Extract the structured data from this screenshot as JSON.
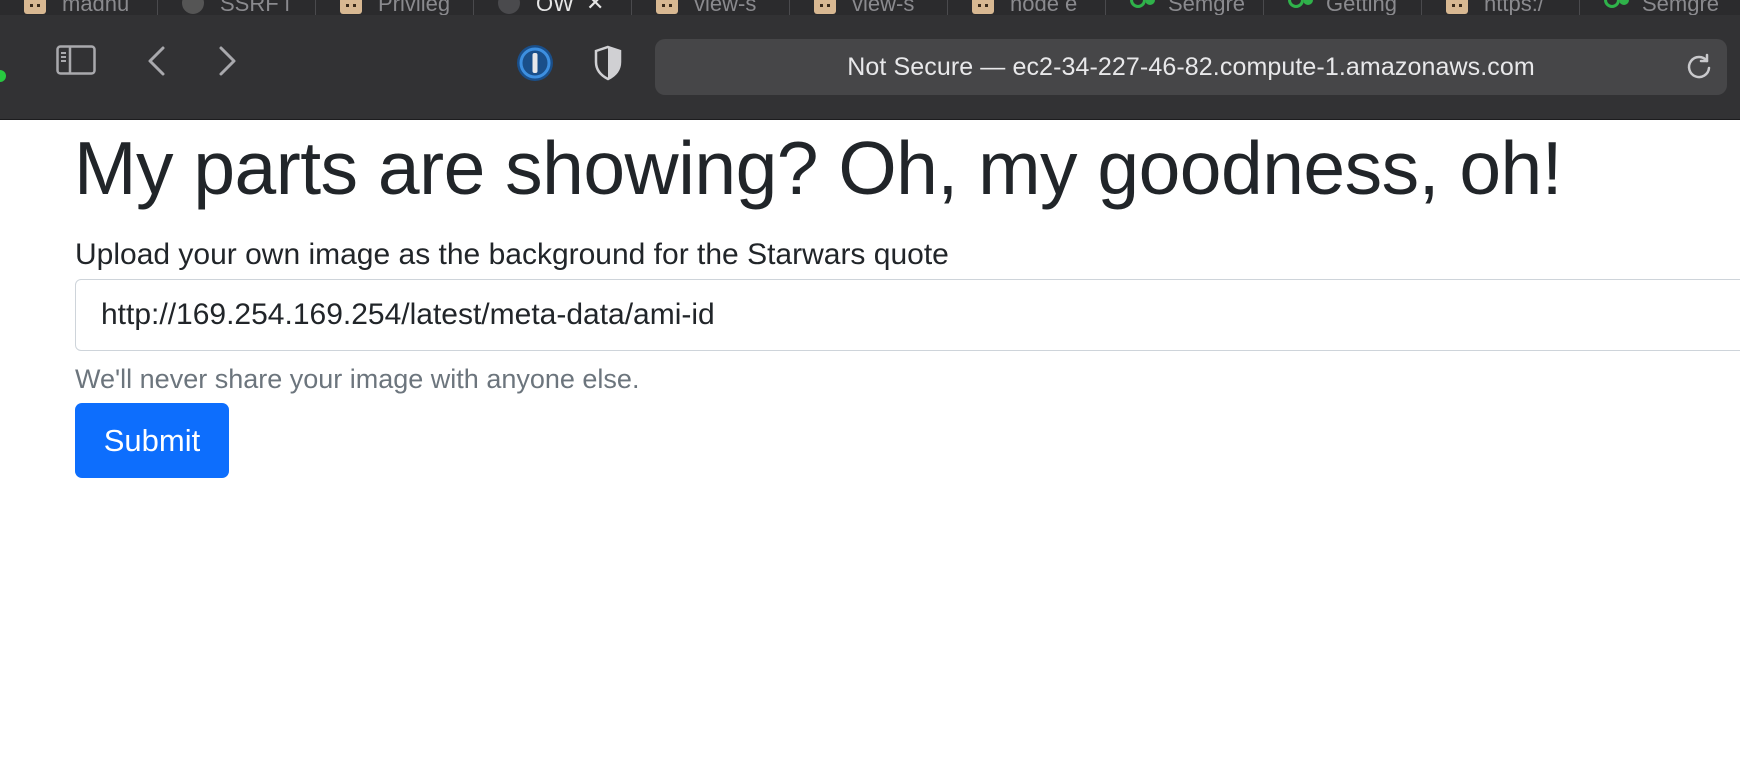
{
  "tabs": [
    {
      "title": "madhu",
      "favicon": "avatar-favicon"
    },
    {
      "title": "SSRF i",
      "favicon": "dark-favicon"
    },
    {
      "title": "Privileg",
      "favicon": "avatar-favicon"
    },
    {
      "title": "OW",
      "favicon": "globe-favicon",
      "active": true,
      "close": "✕"
    },
    {
      "title": "view-s",
      "favicon": "avatar-favicon"
    },
    {
      "title": "view-s",
      "favicon": "avatar-favicon"
    },
    {
      "title": "node e",
      "favicon": "avatar-favicon"
    },
    {
      "title": "Semgre",
      "favicon": "semgrep-favicon"
    },
    {
      "title": "Getting",
      "favicon": "semgrep-favicon"
    },
    {
      "title": "https:/",
      "favicon": "avatar-favicon"
    },
    {
      "title": "Semgre",
      "favicon": "semgrep-favicon"
    }
  ],
  "toolbar": {
    "address_text": "Not Secure — ec2-34-227-46-82.compute-1.amazonaws.com"
  },
  "page": {
    "heading": "My parts are showing? Oh, my goodness, oh!",
    "upload_label": "Upload your own image as the background for the Starwars quote",
    "url_value": "http://169.254.169.254/latest/meta-data/ami-id",
    "help_text": "We'll never share your image with anyone else.",
    "submit_label": "Submit"
  },
  "colors": {
    "primary": "#0d6efd",
    "text": "#212529",
    "muted": "#6c757d",
    "chrome": "#323234",
    "password_manager": "#3d8fe0"
  }
}
